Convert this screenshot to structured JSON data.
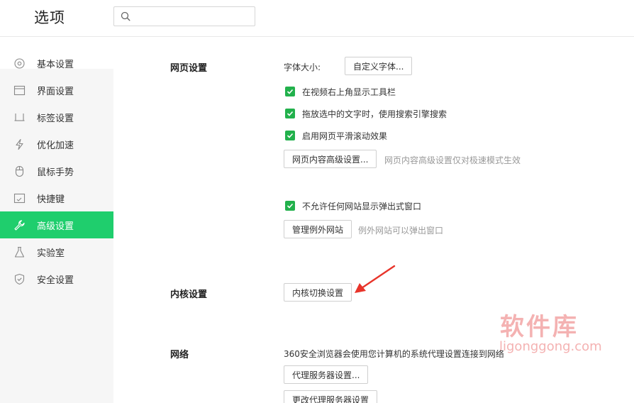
{
  "header": {
    "title": "选项",
    "search_placeholder": ""
  },
  "sidebar": {
    "items": [
      {
        "label": "基本设置",
        "icon": "gear-icon",
        "active": false
      },
      {
        "label": "界面设置",
        "icon": "window-icon",
        "active": false
      },
      {
        "label": "标签设置",
        "icon": "tab-icon",
        "active": false
      },
      {
        "label": "优化加速",
        "icon": "lightning-icon",
        "active": false
      },
      {
        "label": "鼠标手势",
        "icon": "mouse-icon",
        "active": false
      },
      {
        "label": "快捷键",
        "icon": "keyboard-icon",
        "active": false
      },
      {
        "label": "高级设置",
        "icon": "wrench-icon",
        "active": true
      },
      {
        "label": "实验室",
        "icon": "flask-icon",
        "active": false
      },
      {
        "label": "安全设置",
        "icon": "shield-icon",
        "active": false
      }
    ],
    "accent_color": "#1fce6d"
  },
  "webpage": {
    "title": "网页设置",
    "font_size_label": "字体大小:",
    "custom_font_button": "自定义字体...",
    "checkboxes": [
      {
        "label": "在视频右上角显示工具栏",
        "checked": true
      },
      {
        "label": "拖放选中的文字时，使用搜索引擎搜索",
        "checked": true
      },
      {
        "label": "启用网页平滑滚动效果",
        "checked": true
      }
    ],
    "advanced_button": "网页内容高级设置...",
    "advanced_hint": "网页内容高级设置仅对极速模式生效",
    "popup_checkbox": {
      "label": "不允许任何网站显示弹出式窗口",
      "checked": true
    },
    "manage_exceptions_button": "管理例外网站",
    "exceptions_hint": "例外网站可以弹出窗口"
  },
  "kernel": {
    "title": "内核设置",
    "switch_button": "内核切换设置"
  },
  "network": {
    "title": "网络",
    "description": "360安全浏览器会使用您计算机的系统代理设置连接到网络",
    "proxy_button": "代理服务器设置...",
    "change_proxy_button": "更改代理服务器设置"
  },
  "watermark": {
    "text_cn": "软件库",
    "text_en": "ligonggong.com"
  },
  "colors": {
    "checkbox": "#22b14c",
    "arrow": "#e8342a"
  }
}
